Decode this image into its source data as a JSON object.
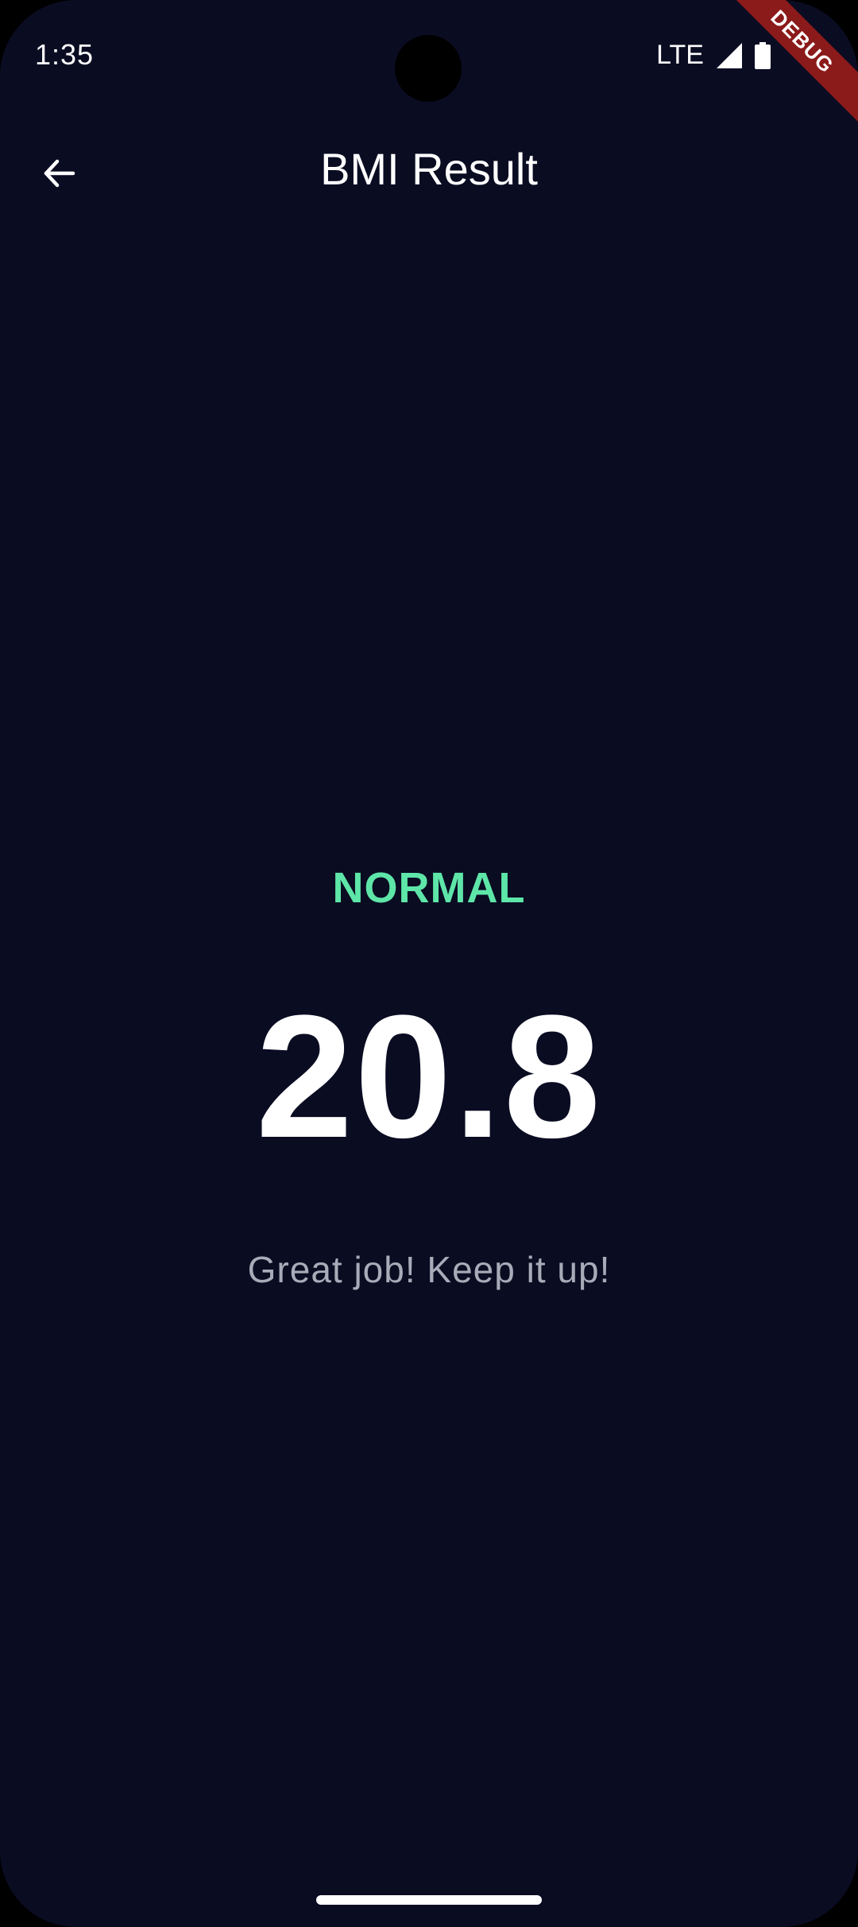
{
  "status_bar": {
    "time": "1:35",
    "network": "LTE",
    "icons": [
      "signal-icon",
      "battery-icon"
    ]
  },
  "debug_banner": {
    "label": "DEBUG",
    "color": "#8b1a1a"
  },
  "app_bar": {
    "back_icon": "arrow-back-icon",
    "title": "BMI Result"
  },
  "result": {
    "status": "NORMAL",
    "status_color": "#5ee6a8",
    "value": "20.8",
    "message": "Great job! Keep it up!"
  },
  "colors": {
    "background": "#0a0c22",
    "text_primary": "#ffffff",
    "text_secondary": "#a9abb8"
  }
}
